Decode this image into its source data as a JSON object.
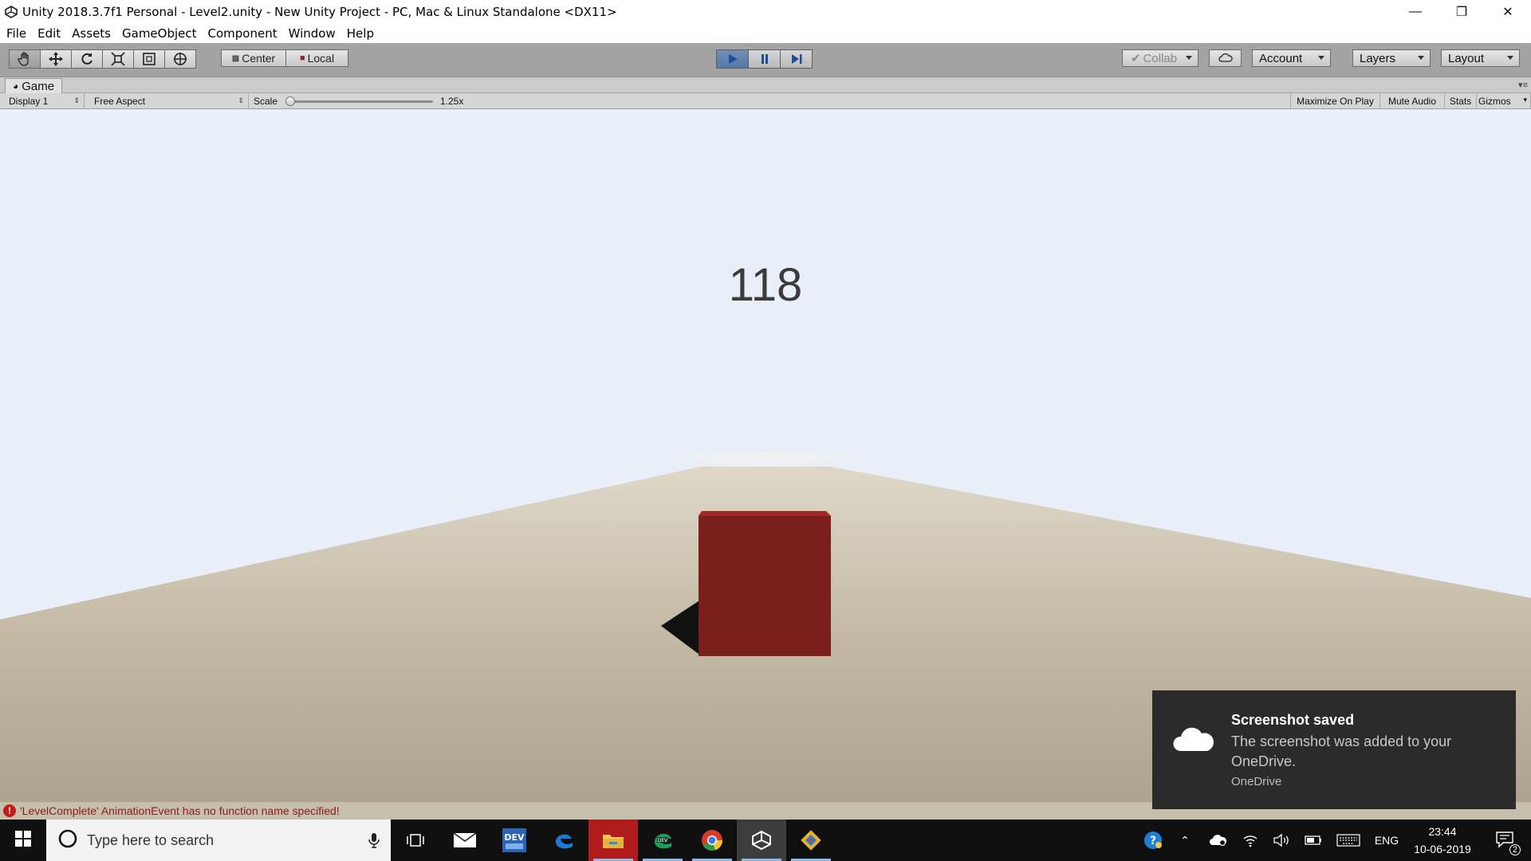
{
  "window": {
    "title": "Unity 2018.3.7f1 Personal - Level2.unity - New Unity Project - PC, Mac & Linux Standalone <DX11>",
    "controls": [
      "minimize-icon",
      "restore-icon",
      "close-icon"
    ]
  },
  "menu": [
    "File",
    "Edit",
    "Assets",
    "GameObject",
    "Component",
    "Window",
    "Help"
  ],
  "toolbar": {
    "tools": [
      "hand-icon",
      "move-icon",
      "rotate-icon",
      "scale-icon",
      "rect-icon",
      "transform-icon"
    ],
    "pivot_center": "Center",
    "pivot_local": "Local",
    "play_controls": [
      "play-icon",
      "pause-icon",
      "step-icon"
    ],
    "collab": "Collab",
    "account": "Account",
    "layers": "Layers",
    "layout": "Layout"
  },
  "game_tab": {
    "label": "Game",
    "display": "Display 1",
    "aspect": "Free Aspect",
    "scale_label": "Scale",
    "scale_value": "1.25x",
    "scale_level": 0.0,
    "maximize": "Maximize On Play",
    "mute": "Mute Audio",
    "stats": "Stats",
    "gizmos": "Gizmos"
  },
  "game": {
    "score": "118",
    "cube_color": "#7b1f1d",
    "sky_color": "#e9eff8",
    "ground_color": "#c2b8a3"
  },
  "status": {
    "message": "'LevelComplete' AnimationEvent has no function name specified!"
  },
  "toast": {
    "title": "Screenshot saved",
    "body": "The screenshot was added to your OneDrive.",
    "source": "OneDrive"
  },
  "taskbar": {
    "search_placeholder": "Type here to search",
    "apps": [
      "task-view-icon",
      "mail-icon",
      "dev-icon",
      "edge-icon",
      "file-explorer-icon",
      "edge-dev-icon",
      "chrome-icon",
      "unity-icon",
      "git-icon"
    ],
    "language": "ENG",
    "time": "23:44",
    "date": "10-06-2019",
    "notifications": "2"
  }
}
